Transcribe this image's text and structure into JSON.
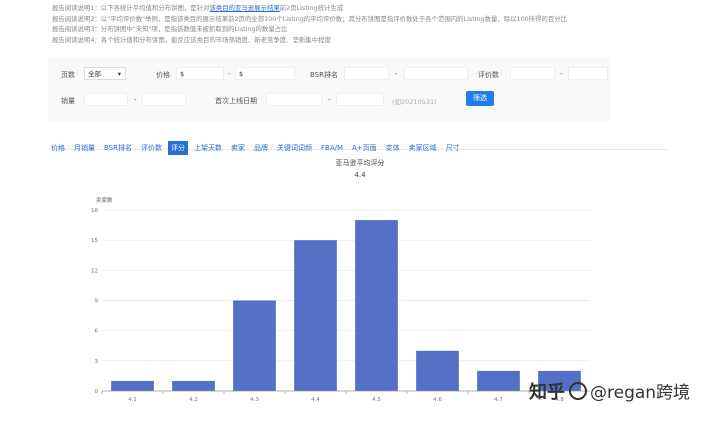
{
  "notes": {
    "line1_prefix": "报告阅读说明1：以下各统计平均值和分布饼图，是针对",
    "line1_link": "该类目的亚马逊展示结果",
    "line1_suffix": "前2页Listing统计生成",
    "line2": "报告阅读说明2：以\"平均评价数\"举例，是指该类目的展示结果前2页的全部100个Listing的平均评价数；其分布饼图是指评价数处于各个范围内的Listing数量，除以100所得的百分比",
    "line3": "报告阅读说明3：分布饼图中\"未知\"项，是指该数值未被抓取到的Listing的数量占比",
    "line4": "报告阅读说明4：各个统计值和分布饼图，能反应该类目的市场热销度、新老竞争度、垄断集中程度"
  },
  "filters": {
    "pages_label": "页数",
    "pages_value": "全部",
    "price_label": "价格",
    "price_min_prefix": "$",
    "price_max_prefix": "$",
    "bsr_label": "BSR排名",
    "reviews_label": "评价数",
    "sales_label": "销量",
    "first_date_label": "首次上线日期",
    "date_hint": "(如20210531)",
    "dash": "-",
    "filter_button": "筛选"
  },
  "tabs": [
    "价格",
    "月销量",
    "BSR排名",
    "评价数",
    "评分",
    "上架天数",
    "卖家",
    "品牌",
    "关键词词频",
    "FBA/M",
    "A+页面",
    "变体",
    "卖家区域",
    "尺寸"
  ],
  "active_tab": 4,
  "watermark": {
    "text": "知乎",
    "at": "@",
    "brand": "regan跨境"
  },
  "chart_data": {
    "type": "bar",
    "title": "亚马逊平均评分",
    "subtitle": "4.4",
    "ylabel": "卖家数",
    "categories": [
      "4.1",
      "4.2",
      "4.3",
      "4.4",
      "4.5",
      "4.6",
      "4.7",
      "4.8"
    ],
    "values": [
      1,
      1,
      9,
      15,
      17,
      4,
      2,
      2
    ],
    "ylim": [
      0,
      18
    ],
    "yticks": [
      0,
      3,
      6,
      9,
      12,
      15,
      18
    ],
    "bar_color": "#5470c6",
    "grid": true
  }
}
